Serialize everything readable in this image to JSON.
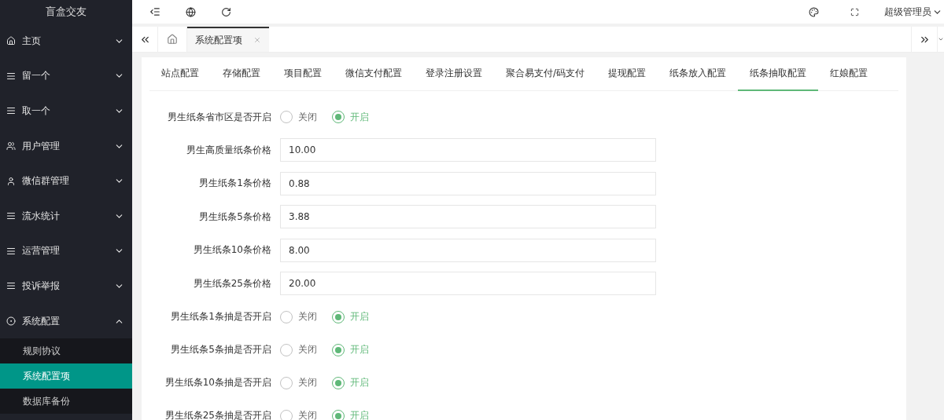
{
  "sidebar": {
    "logo": "盲盒交友",
    "items": [
      {
        "label": "主页",
        "kind": "home",
        "expanded": false
      },
      {
        "label": "留一个",
        "kind": "list",
        "expanded": false
      },
      {
        "label": "取一个",
        "kind": "list",
        "expanded": false
      },
      {
        "label": "用户管理",
        "kind": "users",
        "expanded": false
      },
      {
        "label": "微信群管理",
        "kind": "user",
        "expanded": false
      },
      {
        "label": "流水统计",
        "kind": "list",
        "expanded": false
      },
      {
        "label": "运营管理",
        "kind": "list",
        "expanded": false
      },
      {
        "label": "投诉举报",
        "kind": "list",
        "expanded": false
      },
      {
        "label": "系统配置",
        "kind": "config",
        "expanded": true,
        "children": [
          {
            "label": "规则协议",
            "selected": false
          },
          {
            "label": "系统配置项",
            "selected": true
          },
          {
            "label": "数据库备份",
            "selected": false
          }
        ]
      }
    ]
  },
  "header": {
    "user": "超级管理员"
  },
  "page_tabs": [
    {
      "label": "系统配置项",
      "selected": true
    }
  ],
  "config_tabs": [
    {
      "label": "站点配置",
      "selected": false
    },
    {
      "label": "存储配置",
      "selected": false
    },
    {
      "label": "项目配置",
      "selected": false
    },
    {
      "label": "微信支付配置",
      "selected": false
    },
    {
      "label": "登录注册设置",
      "selected": false
    },
    {
      "label": "聚合易支付/码支付",
      "selected": false
    },
    {
      "label": "提现配置",
      "selected": false
    },
    {
      "label": "纸条放入配置",
      "selected": false
    },
    {
      "label": "纸条抽取配置",
      "selected": true
    },
    {
      "label": "红娘配置",
      "selected": false
    }
  ],
  "form": [
    {
      "kind": "radio",
      "label": "男生纸条省市区是否开启",
      "options": [
        {
          "label": "关闭",
          "selected": false
        },
        {
          "label": "开启",
          "selected": true
        }
      ]
    },
    {
      "kind": "input",
      "label": "男生高质量纸条价格",
      "value": "10.00"
    },
    {
      "kind": "input",
      "label": "男生纸条1条价格",
      "value": "0.88"
    },
    {
      "kind": "input",
      "label": "男生纸条5条价格",
      "value": "3.88"
    },
    {
      "kind": "input",
      "label": "男生纸条10条价格",
      "value": "8.00"
    },
    {
      "kind": "input",
      "label": "男生纸条25条价格",
      "value": "20.00"
    },
    {
      "kind": "radio",
      "label": "男生纸条1条抽是否开启",
      "options": [
        {
          "label": "关闭",
          "selected": false
        },
        {
          "label": "开启",
          "selected": true
        }
      ]
    },
    {
      "kind": "radio",
      "label": "男生纸条5条抽是否开启",
      "options": [
        {
          "label": "关闭",
          "selected": false
        },
        {
          "label": "开启",
          "selected": true
        }
      ]
    },
    {
      "kind": "radio",
      "label": "男生纸条10条抽是否开启",
      "options": [
        {
          "label": "关闭",
          "selected": false
        },
        {
          "label": "开启",
          "selected": true
        }
      ]
    },
    {
      "kind": "radio",
      "label": "男生纸条25条抽是否开启",
      "options": [
        {
          "label": "关闭",
          "selected": false
        },
        {
          "label": "开启",
          "selected": true
        }
      ]
    }
  ]
}
